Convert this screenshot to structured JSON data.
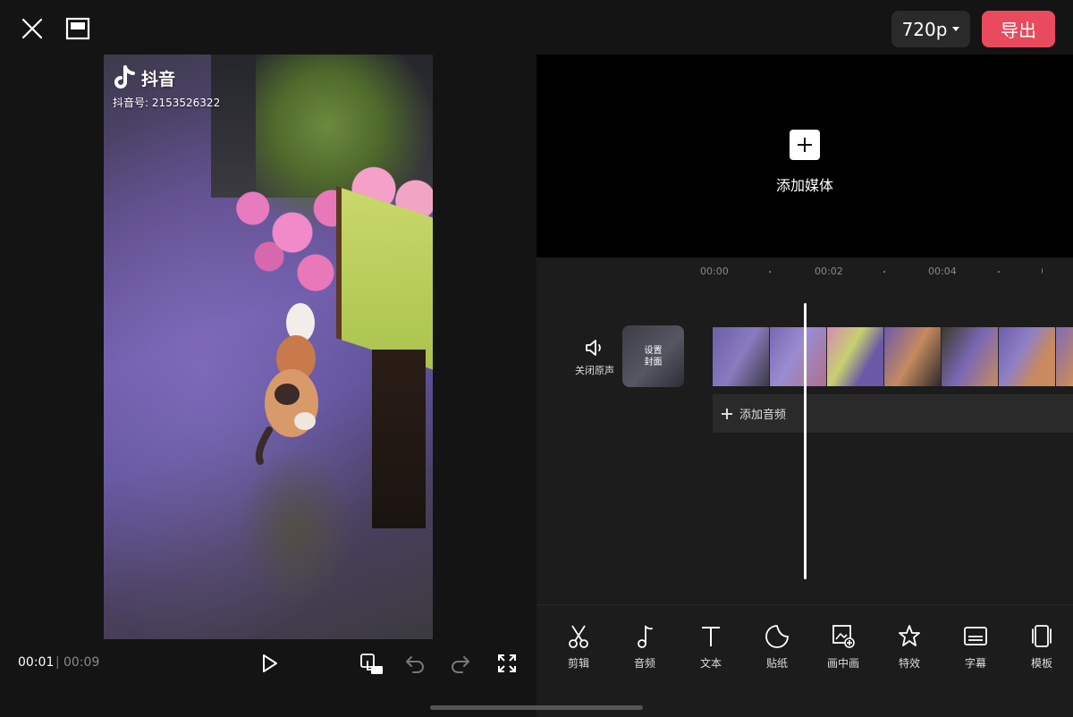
{
  "header": {
    "resolution": "720p",
    "export_label": "导出"
  },
  "preview": {
    "watermark_name": "抖音",
    "watermark_id": "抖音号: 2153526322"
  },
  "playback": {
    "current_time": "00:01",
    "separator": "|",
    "total_time": "00:09"
  },
  "media": {
    "add_media_label": "添加媒体"
  },
  "timeline": {
    "ruler": [
      "00:00",
      "00:02",
      "00:04"
    ],
    "mute_label": "关闭原声",
    "cover_label_line1": "设置",
    "cover_label_line2": "封面",
    "add_audio_label": "添加音频"
  },
  "toolbar": {
    "items": [
      {
        "label": "剪辑",
        "icon": "scissors-icon"
      },
      {
        "label": "音频",
        "icon": "music-note-icon"
      },
      {
        "label": "文本",
        "icon": "text-icon"
      },
      {
        "label": "贴纸",
        "icon": "sticker-icon"
      },
      {
        "label": "画中画",
        "icon": "picture-in-picture-icon"
      },
      {
        "label": "特效",
        "icon": "effects-star-icon"
      },
      {
        "label": "字幕",
        "icon": "subtitles-icon"
      },
      {
        "label": "模板",
        "icon": "template-icon"
      }
    ]
  },
  "colors": {
    "accent": "#e94a5d",
    "background": "#141414",
    "panel": "#1c1c1c"
  }
}
